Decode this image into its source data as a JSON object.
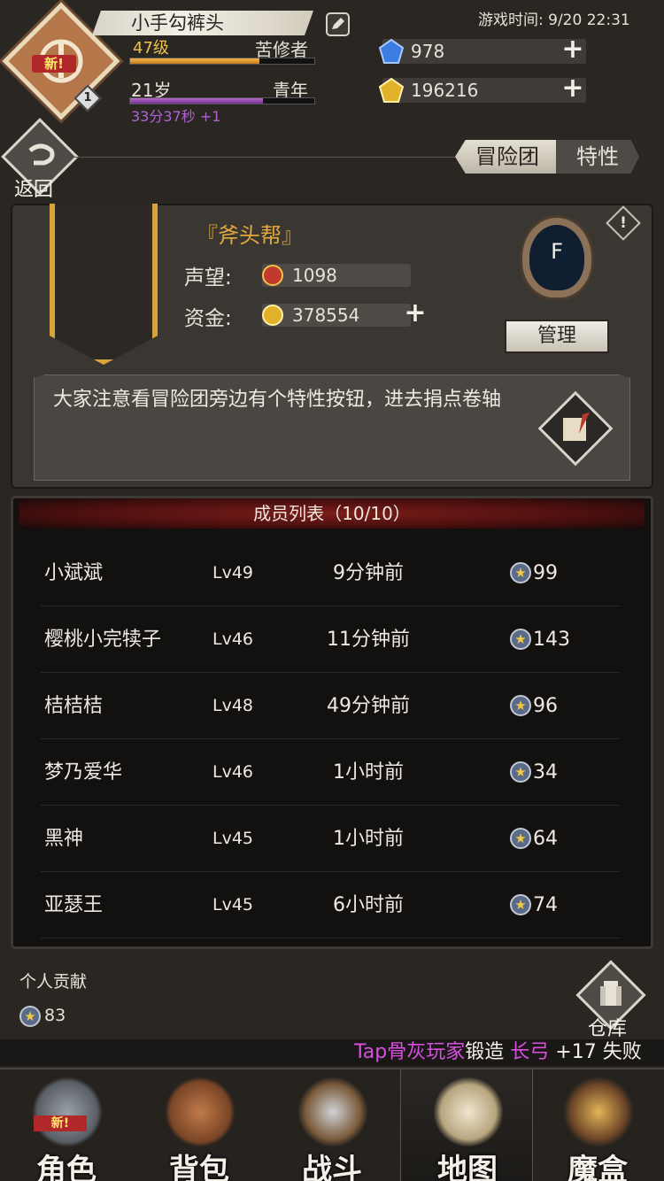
{
  "profile": {
    "new_badge": "新!",
    "level_tag": "1",
    "name": "小手勾裤头",
    "level": "47级",
    "class": "苦修者",
    "exp_fraction": 0.7,
    "age": "21岁",
    "stage": "青年",
    "age_fraction": 0.72,
    "timer": "33分37秒 +1"
  },
  "header": {
    "game_time": "游戏时间: 9/20 22:31",
    "diamonds": "978",
    "gold": "196216",
    "plus": "+"
  },
  "nav_top": {
    "back_label": "返回",
    "tab_active": "冒险团",
    "tab_traits": "特性"
  },
  "guild": {
    "name": "『斧头帮』",
    "reputation_label": "声望:",
    "reputation_value": "1098",
    "funds_label": "资金:",
    "funds_value": "378554",
    "plus": "+",
    "crest_letter": "F",
    "info_symbol": "!",
    "manage_label": "管理",
    "notice": "大家注意看冒险团旁边有个特性按钮，进去捐点卷轴"
  },
  "members": {
    "title": "成员列表（10/10）",
    "rows": [
      {
        "name": "小斌斌",
        "level": "Lv49",
        "last_seen": "9分钟前",
        "contribution": "99"
      },
      {
        "name": "樱桃小完犊子",
        "level": "Lv46",
        "last_seen": "11分钟前",
        "contribution": "143"
      },
      {
        "name": "桔桔桔",
        "level": "Lv48",
        "last_seen": "49分钟前",
        "contribution": "96"
      },
      {
        "name": "梦乃爱华",
        "level": "Lv46",
        "last_seen": "1小时前",
        "contribution": "34"
      },
      {
        "name": "黑神",
        "level": "Lv45",
        "last_seen": "1小时前",
        "contribution": "64"
      },
      {
        "name": "亚瑟王",
        "level": "Lv45",
        "last_seen": "6小时前",
        "contribution": "74"
      }
    ]
  },
  "personal": {
    "label": "个人贡献",
    "value": "83",
    "warehouse_label": "仓库"
  },
  "ticker": {
    "player": "Tap骨灰玩家",
    "action": "锻造",
    "item": "长弓",
    "result": "+17 失败"
  },
  "bottom_nav": {
    "character": "角色",
    "character_new": "新!",
    "bag": "背包",
    "battle": "战斗",
    "map": "地图",
    "magic_box": "魔盒"
  },
  "colors": {
    "accent_gold": "#d8a33a",
    "exp_orange": "#f3b44a",
    "age_purple": "#b063d6",
    "ticker_purple": "#d84fe0",
    "member_header_red": "#7b1e1a"
  }
}
